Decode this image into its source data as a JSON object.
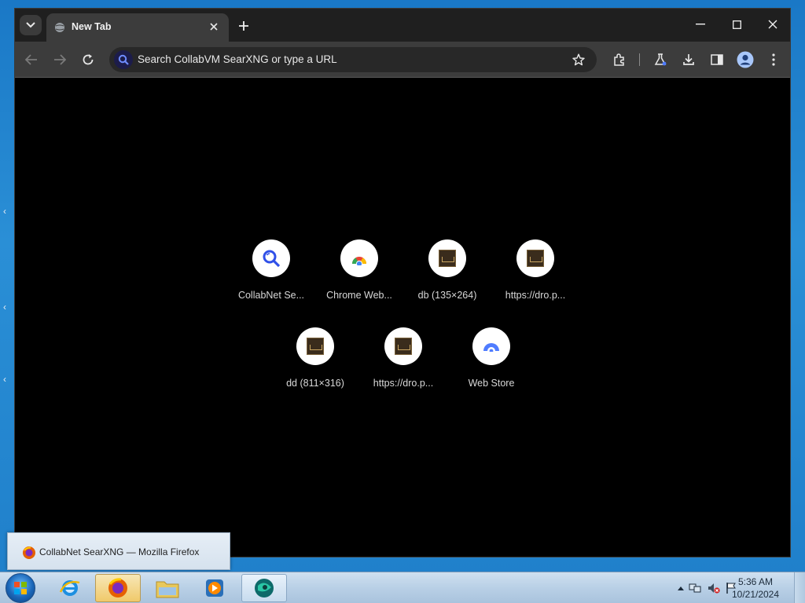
{
  "browser": {
    "tab": {
      "title": "New Tab"
    },
    "window_controls": [
      "minimize",
      "maximize",
      "close"
    ],
    "omnibox": {
      "placeholder": "Search CollabVM SearXNG or type a URL"
    },
    "toolbar_icons": [
      "back-icon",
      "forward-icon",
      "reload-icon",
      "extensions-icon",
      "labs-icon",
      "download-icon",
      "side-panel-icon",
      "profile-icon",
      "menu-icon"
    ]
  },
  "shortcuts": [
    {
      "label": "CollabNet Se...",
      "icon": "searxng-icon"
    },
    {
      "label": "Chrome Web...",
      "icon": "chrome-web-store-icon"
    },
    {
      "label": "db (135×264)",
      "icon": "thumbnail-icon"
    },
    {
      "label": "https://dro.p...",
      "icon": "thumbnail-icon"
    },
    {
      "label": "dd (811×316)",
      "icon": "thumbnail-icon"
    },
    {
      "label": "https://dro.p...",
      "icon": "thumbnail-icon"
    },
    {
      "label": "Web Store",
      "icon": "web-store-icon"
    }
  ],
  "taskbar": {
    "preview_title": "CollabNet SearXNG — Mozilla Firefox",
    "buttons": [
      "internet-explorer",
      "firefox",
      "file-explorer",
      "media-player",
      "collabvm"
    ],
    "clock": {
      "time": "5:36 AM",
      "date": "10/21/2024"
    }
  },
  "colors": {
    "browser_bg": "#000000",
    "tabstrip": "#1f1f1f",
    "toolbar": "#3c3c3c",
    "desktop": "#1f7fca",
    "accent_blue": "#4f7cff"
  }
}
